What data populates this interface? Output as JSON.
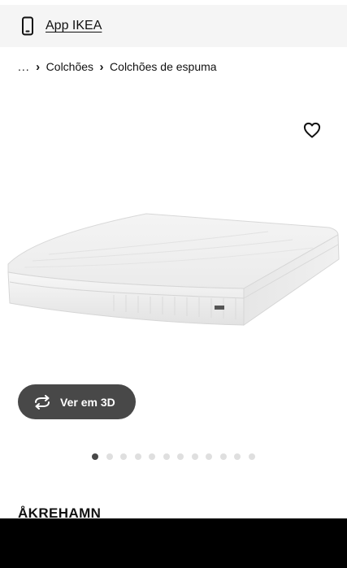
{
  "app_banner": {
    "label": "App IKEA",
    "icon": "smartphone-icon"
  },
  "breadcrumb": {
    "ellipsis": "...",
    "items": [
      "Colchões",
      "Colchões de espuma"
    ]
  },
  "product": {
    "name": "ÅKREHAMN",
    "image_alt": "mattress"
  },
  "gallery": {
    "view_3d_label": "Ver em 3D",
    "favorite_icon": "heart-outline-icon",
    "image_count": 12,
    "active_index": 0
  },
  "colors": {
    "banner_bg": "#f5f5f5",
    "button_bg": "#484848",
    "dot_active": "#484848",
    "dot_inactive": "#dfdfdf"
  }
}
